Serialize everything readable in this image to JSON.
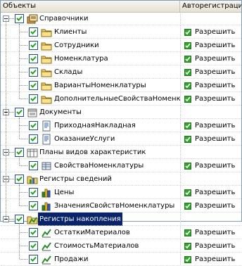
{
  "columns": {
    "objects": "Объекты",
    "autoreg": "Авторегистрация"
  },
  "colors": {
    "selection": "#0a246a",
    "allow": "#31a42b",
    "grid_border": "#7f9db9"
  },
  "rows": [
    {
      "level": 0,
      "expander": true,
      "checked": true,
      "icon": "catalogs-folder-icon",
      "label": "Справочники",
      "value": ""
    },
    {
      "level": 1,
      "expander": false,
      "checked": true,
      "icon": "catalog-item-icon",
      "label": "Клиенты",
      "value": "Разрешить"
    },
    {
      "level": 1,
      "expander": false,
      "checked": true,
      "icon": "catalog-item-icon",
      "label": "Сотрудники",
      "value": "Разрешить"
    },
    {
      "level": 1,
      "expander": false,
      "checked": true,
      "icon": "catalog-item-icon",
      "label": "Номенклатура",
      "value": "Разрешить"
    },
    {
      "level": 1,
      "expander": false,
      "checked": true,
      "icon": "catalog-item-icon",
      "label": "Склады",
      "value": "Разрешить"
    },
    {
      "level": 1,
      "expander": false,
      "checked": true,
      "icon": "catalog-item-icon",
      "label": "ВариантыНоменклатуры",
      "value": "Разрешить"
    },
    {
      "level": 1,
      "expander": false,
      "checked": true,
      "icon": "catalog-item-icon",
      "label": "ДополнительныеСвойстваНоменклату...",
      "value": "Разрешить"
    },
    {
      "level": 0,
      "expander": true,
      "checked": true,
      "icon": "documents-folder-icon",
      "label": "Документы",
      "value": ""
    },
    {
      "level": 1,
      "expander": false,
      "checked": true,
      "icon": "document-item-icon",
      "label": "ПриходнаяНакладная",
      "value": "Разрешить"
    },
    {
      "level": 1,
      "expander": false,
      "checked": true,
      "icon": "document-item-icon",
      "label": "ОказаниеУслуги",
      "value": "Разрешить"
    },
    {
      "level": 0,
      "expander": true,
      "checked": true,
      "icon": "characteristics-folder-icon",
      "label": "Планы видов характеристик",
      "value": ""
    },
    {
      "level": 1,
      "expander": false,
      "checked": true,
      "icon": "characteristic-item-icon",
      "label": "СвойстваНоменклатуры",
      "value": "Разрешить"
    },
    {
      "level": 0,
      "expander": true,
      "checked": true,
      "icon": "info-registers-folder-icon",
      "label": "Регистры сведений",
      "value": ""
    },
    {
      "level": 1,
      "expander": false,
      "checked": true,
      "icon": "info-register-item-icon",
      "label": "Цены",
      "value": "Разрешить"
    },
    {
      "level": 1,
      "expander": false,
      "checked": true,
      "icon": "info-register-item-icon",
      "label": "ЗначенияСвойствНоменклатуры",
      "value": "Разрешить"
    },
    {
      "level": 0,
      "expander": true,
      "checked": true,
      "icon": "accumulation-registers-folder-icon",
      "label": "Регистры накопления",
      "value": "",
      "selected": true
    },
    {
      "level": 1,
      "expander": false,
      "checked": true,
      "icon": "accumulation-register-item-icon",
      "label": "ОстаткиМатериалов",
      "value": "Разрешить"
    },
    {
      "level": 1,
      "expander": false,
      "checked": true,
      "icon": "accumulation-register-item-icon",
      "label": "СтоимостьМатериалов",
      "value": "Разрешить"
    },
    {
      "level": 1,
      "expander": false,
      "checked": true,
      "icon": "accumulation-register-item-icon",
      "label": "Продажи",
      "value": "Разрешить"
    }
  ]
}
